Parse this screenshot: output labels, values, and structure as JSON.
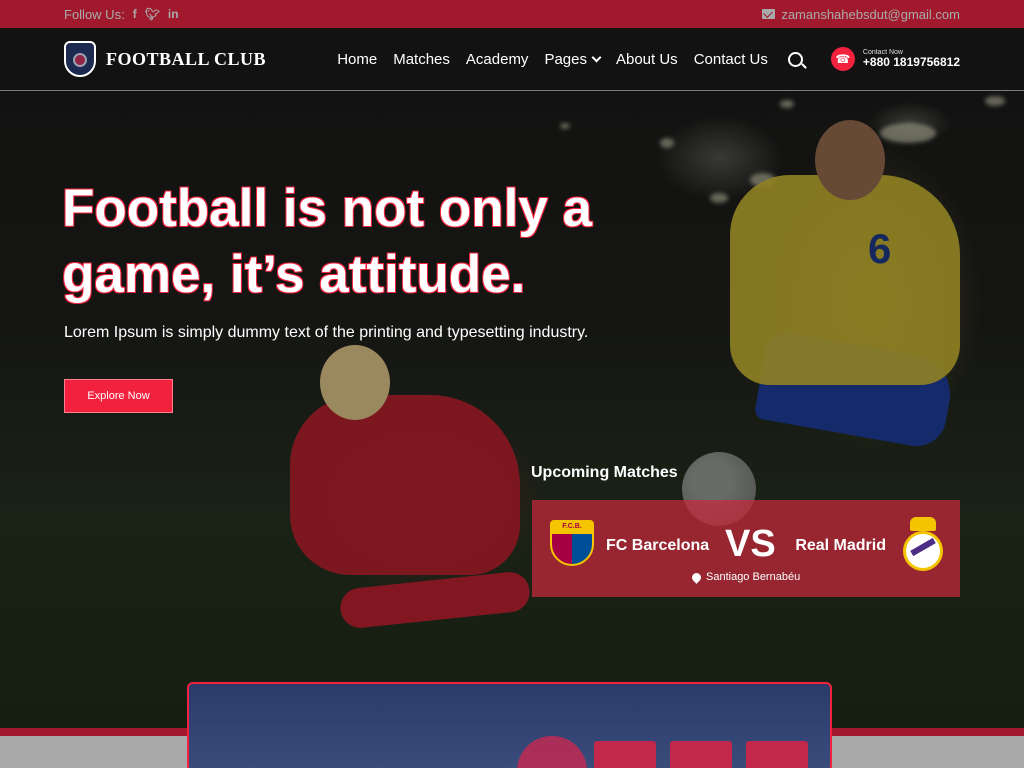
{
  "topbar": {
    "follow_label": "Follow Us:",
    "social_icons": [
      "facebook-icon",
      "twitter-icon",
      "linkedin-icon"
    ],
    "email": "zamanshahebsdut@gmail.com"
  },
  "navbar": {
    "brand": "FOOTBALL CLUB",
    "menu": [
      "Home",
      "Matches",
      "Academy",
      "Pages",
      "About Us",
      "Contact Us"
    ],
    "contact_label": "Contact Now",
    "contact_number": "+880 1819756812"
  },
  "hero": {
    "headline_line1": "Football is not only a",
    "headline_line2": "game, it’s attitude.",
    "subtext": "Lorem Ipsum is simply dummy text of the printing and typesetting industry.",
    "cta": "Explore Now",
    "player_number": "6"
  },
  "upcoming": {
    "title": "Upcoming Matches",
    "home_team": "FC Barcelona",
    "home_crest_text": "F.C.B.",
    "vs": "VS",
    "away_team": "Real Madrid",
    "venue": "Santiago Bernabéu"
  },
  "colors": {
    "accent": "#f2223f",
    "navy": "#2a3b6a"
  }
}
